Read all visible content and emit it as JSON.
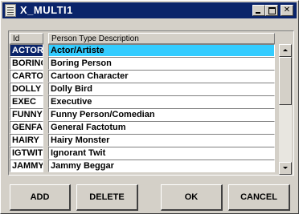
{
  "window": {
    "title": "X_MULTI1",
    "icon": "document-icon",
    "controls": [
      "minimize",
      "maximize",
      "close"
    ],
    "close_glyph": "✕"
  },
  "grid": {
    "columns": [
      "Id",
      "Person Type Description"
    ],
    "selected_index": 0,
    "rows": [
      {
        "id": "ACTOR",
        "desc": "Actor/Artiste"
      },
      {
        "id": "BORING",
        "desc": "Boring Person"
      },
      {
        "id": "CARTOON",
        "desc": "Cartoon Character"
      },
      {
        "id": "DOLLY",
        "desc": "Dolly Bird"
      },
      {
        "id": "EXEC",
        "desc": "Executive"
      },
      {
        "id": "FUNNY",
        "desc": "Funny Person/Comedian"
      },
      {
        "id": "GENFAC",
        "desc": "General Factotum"
      },
      {
        "id": "HAIRY",
        "desc": "Hairy Monster"
      },
      {
        "id": "IGTWIT",
        "desc": "Ignorant Twit"
      },
      {
        "id": "JAMMY",
        "desc": "Jammy Beggar"
      }
    ]
  },
  "buttons": {
    "add": "ADD",
    "delete": "DELETE",
    "ok": "OK",
    "cancel": "CANCEL"
  },
  "colors": {
    "titlebar": "#0a246a",
    "selected_id": "#0a246a",
    "selected_desc": "#33ccff",
    "face": "#d4d0c8"
  }
}
